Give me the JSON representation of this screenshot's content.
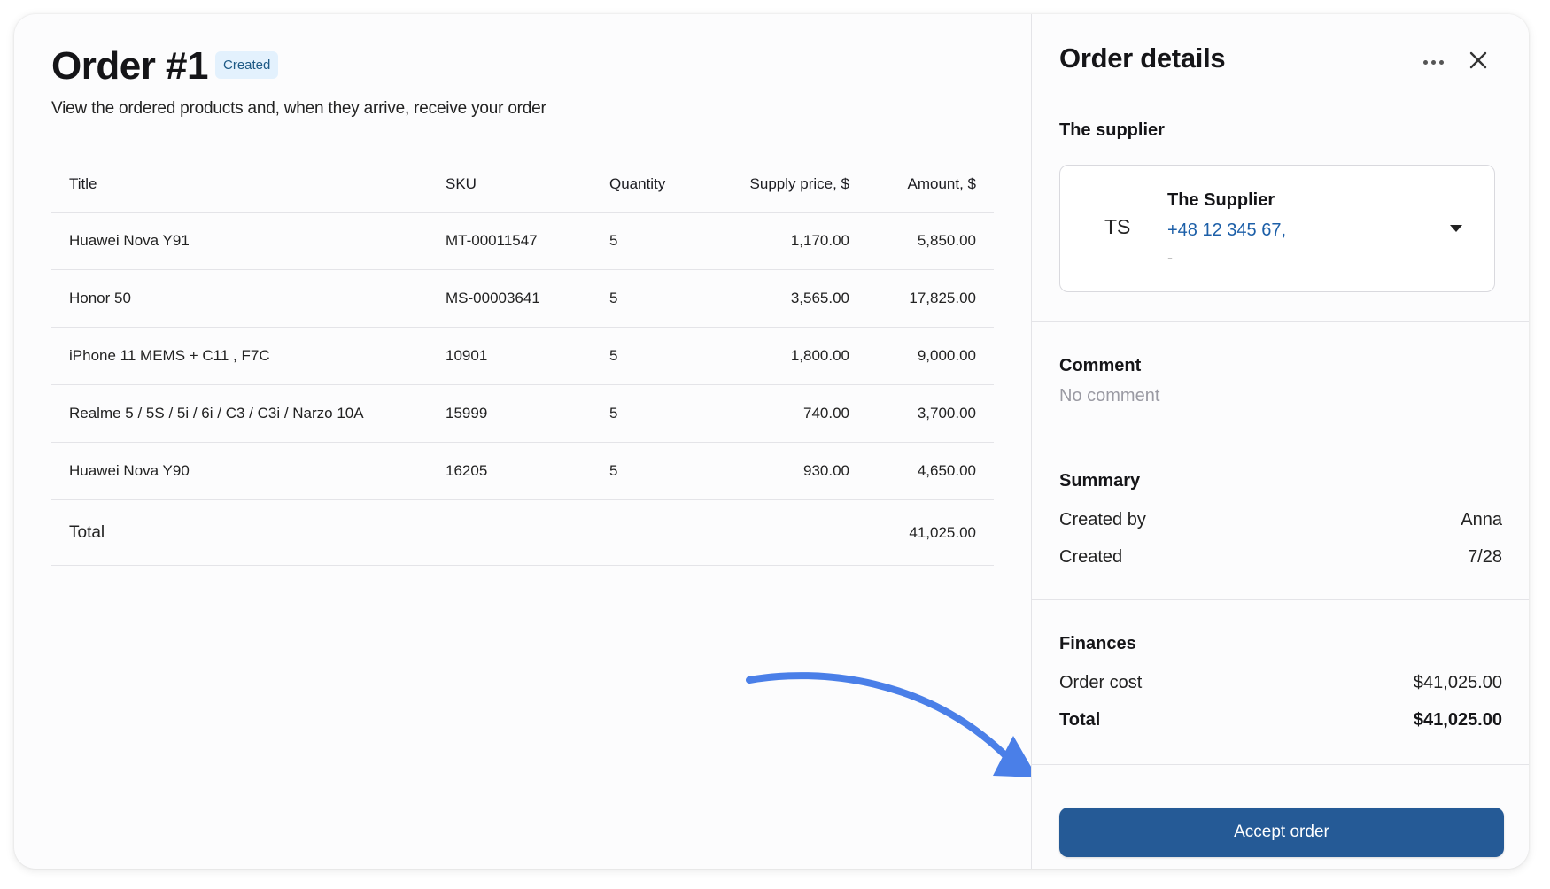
{
  "order": {
    "title": "Order #1",
    "status": "Created",
    "subtitle": "View the ordered products and, when they arrive, receive your order"
  },
  "table": {
    "columns": [
      "Title",
      "SKU",
      "Quantity",
      "Supply price, $",
      "Amount, $"
    ],
    "rows": [
      {
        "title": "Huawei Nova Y91",
        "sku": "MT-00011547",
        "qty": "5",
        "price": "1,170.00",
        "amount": "5,850.00"
      },
      {
        "title": "Honor 50",
        "sku": "MS-00003641",
        "qty": "5",
        "price": "3,565.00",
        "amount": "17,825.00"
      },
      {
        "title": "iPhone 11 MEMS + C11 , F7C",
        "sku": "10901",
        "qty": "5",
        "price": "1,800.00",
        "amount": "9,000.00"
      },
      {
        "title": "Realme 5 / 5S / 5i / 6i / C3 / C3i / Narzo 10A",
        "sku": "15999",
        "qty": "5",
        "price": "740.00",
        "amount": "3,700.00"
      },
      {
        "title": "Huawei Nova Y90",
        "sku": "16205",
        "qty": "5",
        "price": "930.00",
        "amount": "4,650.00"
      }
    ],
    "total_label": "Total",
    "total_amount": "41,025.00"
  },
  "panel": {
    "title": "Order details",
    "supplier_section": "The supplier",
    "supplier": {
      "initials": "TS",
      "name": "The Supplier",
      "phone": "+48 12 345 67,",
      "extra": "-"
    },
    "comment_section": "Comment",
    "comment_value": "No comment",
    "summary_section": "Summary",
    "summary": {
      "created_by_label": "Created by",
      "created_by_value": "Anna",
      "created_label": "Created",
      "created_value": "7/28"
    },
    "finances_section": "Finances",
    "finances": {
      "order_cost_label": "Order cost",
      "order_cost_value": "$41,025.00",
      "total_label": "Total",
      "total_value": "$41,025.00"
    },
    "accept_label": "Accept order"
  },
  "colors": {
    "accent": "#255a96",
    "badge_bg": "#e3f1fd",
    "badge_text": "#1e5a86",
    "link": "#1c5fa8",
    "arrow": "#4a7fe8"
  }
}
